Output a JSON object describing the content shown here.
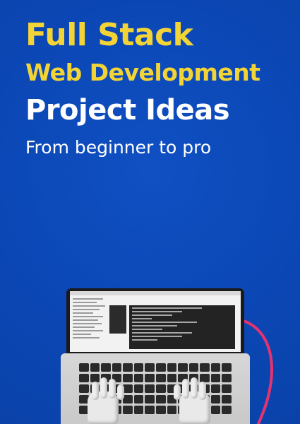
{
  "title": {
    "line1": "Full Stack",
    "line2": "Web Development",
    "line3": "Project Ideas"
  },
  "subtitle": "From beginner to pro",
  "colors": {
    "background": "#0b47b5",
    "title_accent": "#f3d437",
    "title_main": "#ffffff",
    "cable": "#e6336f"
  },
  "illustration": {
    "name": "laptop-typing-illustration"
  }
}
